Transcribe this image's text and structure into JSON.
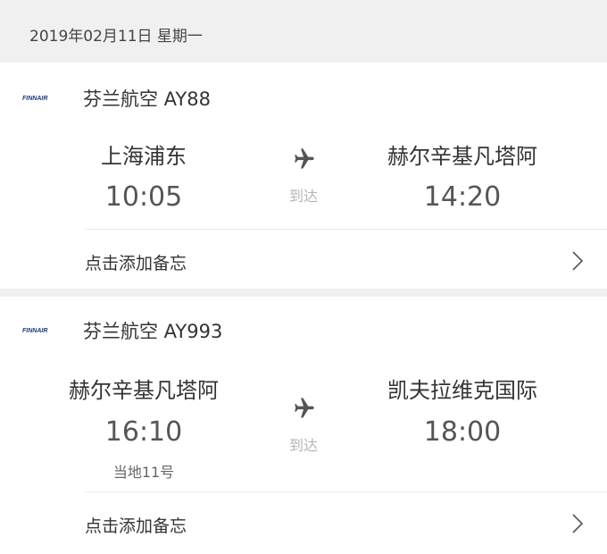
{
  "date_header": {
    "text": "2019年02月11日 星期一"
  },
  "flights": [
    {
      "logo_text": "FINNAIR",
      "airline": "芬兰航空 AY88",
      "from_city": "上海浦东",
      "from_time": "10:05",
      "from_note": "",
      "status": "到达",
      "to_city": "赫尔辛基凡塔阿",
      "to_time": "14:20",
      "memo": "点击添加备忘"
    },
    {
      "logo_text": "FINNAIR",
      "airline": "芬兰航空 AY993",
      "from_city": "赫尔辛基凡塔阿",
      "from_time": "16:10",
      "from_note": "当地11号",
      "status": "到达",
      "to_city": "凯夫拉维克国际",
      "to_time": "18:00",
      "memo": "点击添加备忘"
    }
  ],
  "colors": {
    "background": "#f0f0f0",
    "card": "#ffffff",
    "brand": "#1a3a7a",
    "icon": "#555555"
  },
  "icons": {
    "logo": "finnair-logo-icon",
    "plane": "airplane-icon",
    "chevron": "chevron-right-icon"
  }
}
